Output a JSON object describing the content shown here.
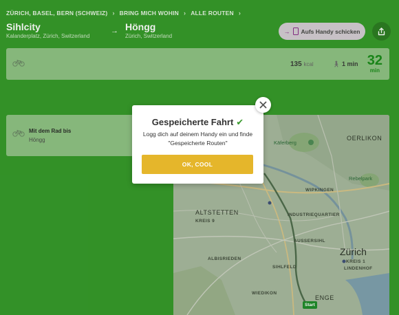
{
  "breadcrumb": [
    "ZÜRICH, BASEL, BERN (SCHWEIZ)",
    "BRING MICH WOHIN",
    "ALLE ROUTEN"
  ],
  "route": {
    "from_name": "Sihlcity",
    "from_address": "Kalanderplatz, Zürich, Switzerland",
    "to_name": "Höngg",
    "to_address": "Zürich, Switzerland"
  },
  "header": {
    "send_label": "Aufs Handy schicken"
  },
  "summary": {
    "kcal_value": "135",
    "kcal_unit": "kcal",
    "walk_label": "1 min",
    "minutes": "32",
    "minutes_unit": "min"
  },
  "leg": {
    "title": "Mit dem Rad bis",
    "subtitle": "Höngg"
  },
  "map": {
    "labels": {
      "kaeferberg": "Käferberg",
      "oerlikon": "OERLIKON",
      "rebelpark": "Rebelpark",
      "wipkingen": "WIPKINGEN",
      "altstetten": "ALTSTETTEN",
      "kreis9": "KREIS 9",
      "industriequartier": "INDUSTRIEQUARTIER",
      "aussersihl": "AUSSERSIHL",
      "albisrieden": "ALBISRIEDEN",
      "sihlfeld": "SIHLFELD",
      "zuerich": "Zürich",
      "kreis1": "KREIS 1",
      "lindenhof": "LINDENHOF",
      "wiedikon": "WIEDIKON",
      "enge": "ENGE",
      "start": "Start"
    }
  },
  "modal": {
    "title": "Gespeicherte Fahrt",
    "text": "Logg dich auf deinem Handy ein und finde \"Gespeicherte Routen\"",
    "ok_label": "OK, COOL"
  },
  "colors": {
    "brand_green": "#36982a",
    "button_yellow": "#e5b62b",
    "check_green": "#3a9a2e"
  }
}
